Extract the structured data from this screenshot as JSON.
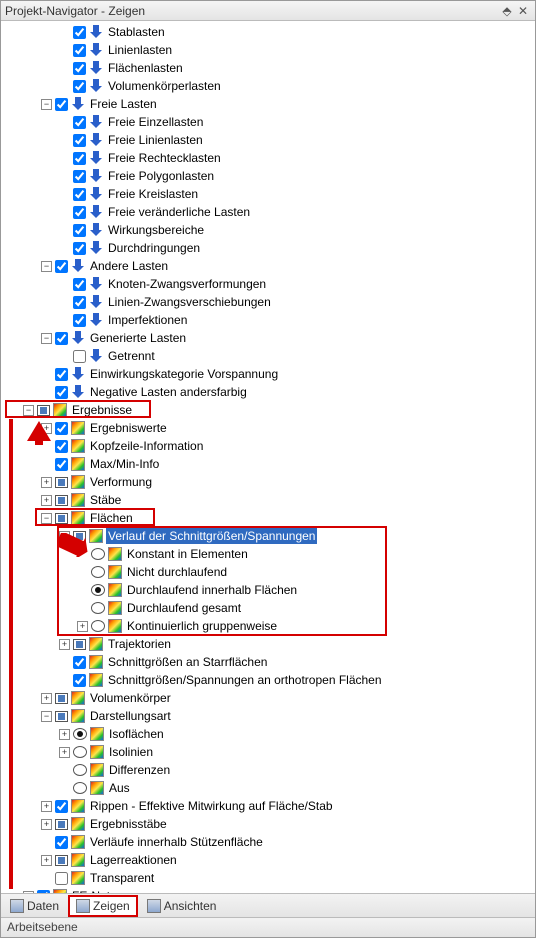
{
  "title": "Projekt-Navigator - Zeigen",
  "status": "Arbeitsebene",
  "tabs": {
    "daten": "Daten",
    "zeigen": "Zeigen",
    "ansichten": "Ansichten"
  },
  "tree": {
    "stablasten": "Stablasten",
    "linienlasten": "Linienlasten",
    "flaechenlasten": "Flächenlasten",
    "volumenkoerperlasten": "Volumenkörperlasten",
    "freie_lasten": "Freie Lasten",
    "freie_einzellasten": "Freie Einzellasten",
    "freie_linienlasten": "Freie Linienlasten",
    "freie_rechtecklasten": "Freie Rechtecklasten",
    "freie_polygonlasten": "Freie Polygonlasten",
    "freie_kreislasten": "Freie Kreislasten",
    "freie_veraenderliche": "Freie veränderliche Lasten",
    "wirkungsbereiche": "Wirkungsbereiche",
    "durchdringungen": "Durchdringungen",
    "andere_lasten": "Andere Lasten",
    "knoten_zwang": "Knoten-Zwangsverformungen",
    "linien_zwang": "Linien-Zwangsverschiebungen",
    "imperfektionen": "Imperfektionen",
    "generierte_lasten": "Generierte Lasten",
    "getrennt": "Getrennt",
    "einwirkungskategorie": "Einwirkungskategorie Vorspannung",
    "negative_lasten": "Negative Lasten andersfarbig",
    "ergebnisse": "Ergebnisse",
    "ergebniswerte": "Ergebniswerte",
    "kopfzeile_info": "Kopfzeile-Information",
    "max_min_info": "Max/Min-Info",
    "verformung": "Verformung",
    "staebe": "Stäbe",
    "flaechen": "Flächen",
    "verlauf": "Verlauf der Schnittgrößen/Spannungen",
    "konstant": "Konstant in Elementen",
    "nicht_durchlaufend": "Nicht durchlaufend",
    "durchlaufend_innerhalb": "Durchlaufend innerhalb Flächen",
    "durchlaufend_gesamt": "Durchlaufend gesamt",
    "kontinuierlich_gruppen": "Kontinuierlich gruppenweise",
    "trajektorien": "Trajektorien",
    "schnittgroessen_starr": "Schnittgrößen an Starrflächen",
    "schnittgroessen_ortho": "Schnittgrößen/Spannungen an orthotropen Flächen",
    "volumenkoerper": "Volumenkörper",
    "darstellungsart": "Darstellungsart",
    "isoflaechen": "Isoflächen",
    "isolinien": "Isolinien",
    "differenzen": "Differenzen",
    "aus": "Aus",
    "rippen": "Rippen - Effektive Mitwirkung auf Fläche/Stab",
    "ergebnisstaebe": "Ergebnisstäbe",
    "verlaeufe_stuetz": "Verläufe innerhalb Stützenfläche",
    "lagerreaktionen": "Lagerreaktionen",
    "transparent": "Transparent",
    "fe_netz": "FE-Netz"
  }
}
